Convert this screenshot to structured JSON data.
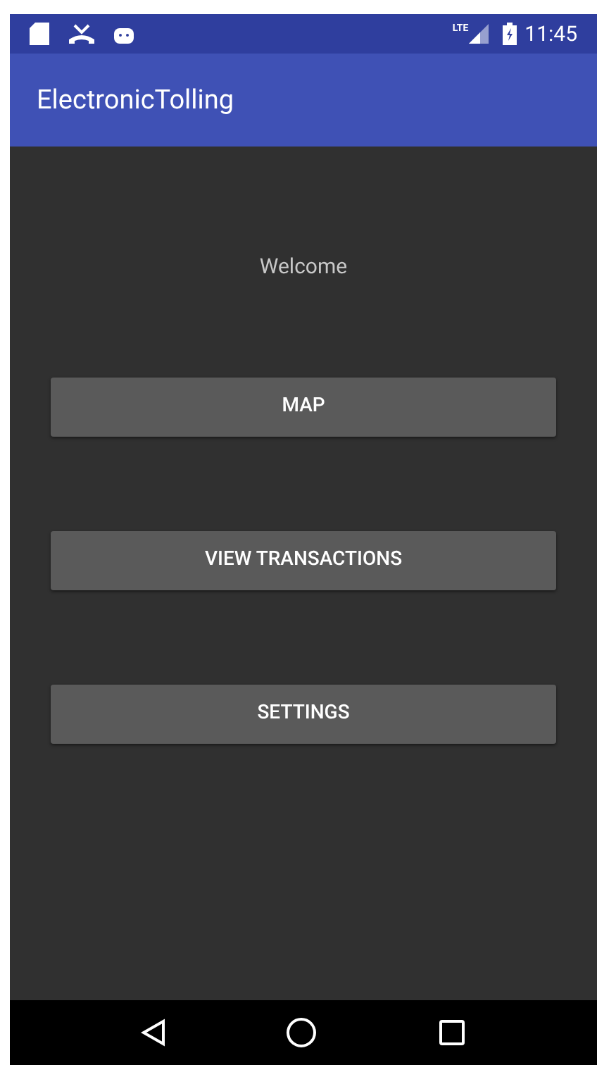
{
  "status_bar": {
    "network": "LTE",
    "time": "11:45"
  },
  "app_bar": {
    "title": "ElectronicTolling"
  },
  "welcome": "Welcome",
  "buttons": [
    "MAP",
    "VIEW TRANSACTIONS",
    "SETTINGS"
  ]
}
